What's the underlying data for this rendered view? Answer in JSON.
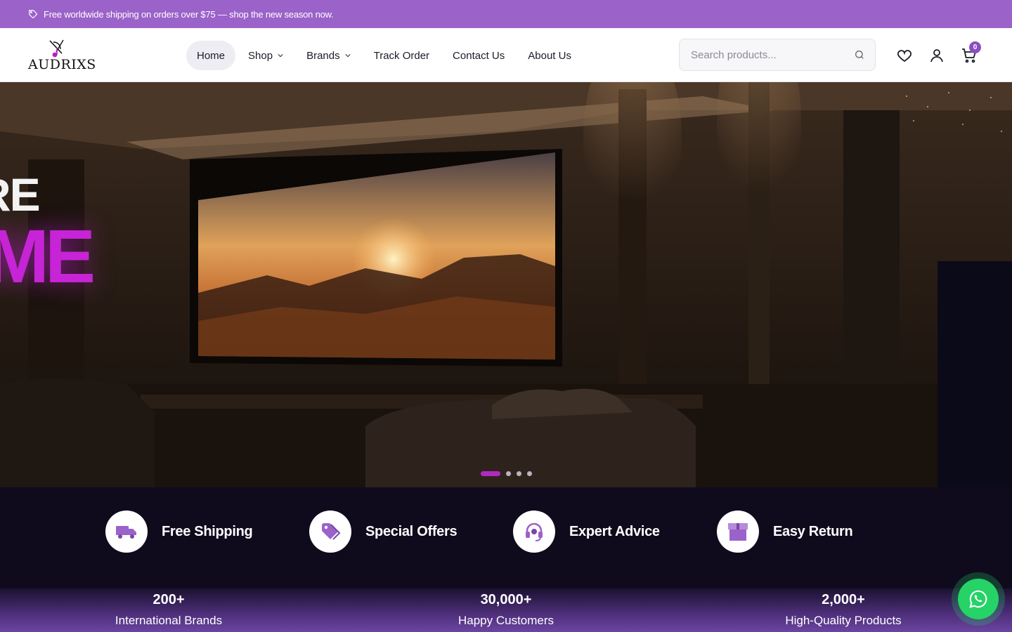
{
  "announcement": {
    "icon": "tag-icon",
    "text": "Free worldwide shipping on orders over $75 — shop the new season now."
  },
  "brand": {
    "name": "AUDRIXS",
    "accent": "#8a4dc2"
  },
  "nav": {
    "items": [
      {
        "label": "Home",
        "active": true,
        "dropdown": false
      },
      {
        "label": "Shop",
        "dropdown": true
      },
      {
        "label": "Brands",
        "dropdown": true
      },
      {
        "label": "Track Order",
        "dropdown": false
      },
      {
        "label": "Contact Us",
        "dropdown": false
      },
      {
        "label": "About Us",
        "dropdown": false
      }
    ]
  },
  "search": {
    "placeholder": "Search products..."
  },
  "header_icons": {
    "wishlist": "heart-icon",
    "account": "user-icon",
    "cart": "cart-icon",
    "cart_count": "0"
  },
  "hero": {
    "line1": "RE",
    "line2": "ME",
    "slides": 4,
    "active_slide": 1
  },
  "features": [
    {
      "icon": "truck-icon",
      "label": "Free Shipping"
    },
    {
      "icon": "tag-icon",
      "label": "Special Offers"
    },
    {
      "icon": "headset-icon",
      "label": "Expert Advice"
    },
    {
      "icon": "box-icon",
      "label": "Easy Return"
    }
  ],
  "stats": [
    {
      "value": "200+",
      "caption": "International Brands"
    },
    {
      "value": "30,000+",
      "caption": "Happy Customers"
    },
    {
      "value": "2,000+",
      "caption": "High-Quality Products"
    }
  ],
  "whatsapp": {
    "icon": "whatsapp-icon",
    "color": "#25d366"
  }
}
